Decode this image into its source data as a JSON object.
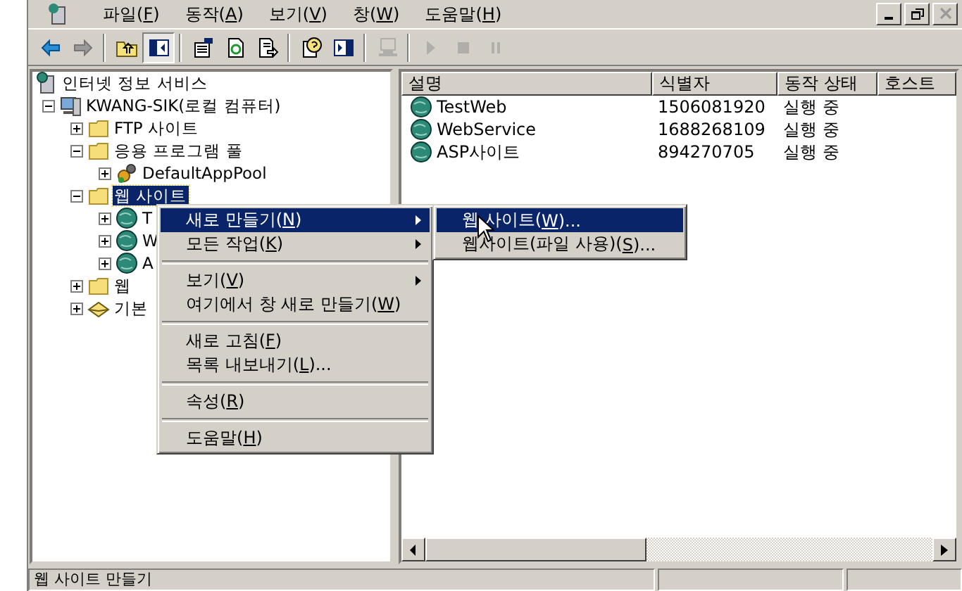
{
  "window": {
    "controls": [
      {
        "kind": "minimize",
        "disabled": false
      },
      {
        "kind": "restore",
        "disabled": false
      },
      {
        "kind": "close",
        "disabled": true
      }
    ]
  },
  "menu_bar": [
    {
      "before": "파일(",
      "key": "F",
      "after": ")"
    },
    {
      "before": "동작(",
      "key": "A",
      "after": ")"
    },
    {
      "before": "보기(",
      "key": "V",
      "after": ")"
    },
    {
      "before": "창(",
      "key": "W",
      "after": ")"
    },
    {
      "before": "도움말(",
      "key": "H",
      "after": ")"
    }
  ],
  "toolbar": [
    {
      "kind": "back",
      "disabled": false,
      "pressed": false
    },
    {
      "kind": "forward",
      "disabled": false,
      "pressed": false
    },
    {
      "kind": "separator"
    },
    {
      "kind": "up",
      "disabled": false,
      "pressed": false
    },
    {
      "kind": "tree",
      "disabled": false,
      "pressed": true
    },
    {
      "kind": "separator"
    },
    {
      "kind": "properties",
      "disabled": false,
      "pressed": false
    },
    {
      "kind": "refresh",
      "disabled": false,
      "pressed": false
    },
    {
      "kind": "export",
      "disabled": false,
      "pressed": false
    },
    {
      "kind": "separator"
    },
    {
      "kind": "help",
      "disabled": false,
      "pressed": false
    },
    {
      "kind": "pane",
      "disabled": false,
      "pressed": false
    },
    {
      "kind": "separator"
    },
    {
      "kind": "computer",
      "disabled": true,
      "pressed": false
    },
    {
      "kind": "separator"
    },
    {
      "kind": "play",
      "disabled": true,
      "pressed": false
    },
    {
      "kind": "stop",
      "disabled": true,
      "pressed": false
    },
    {
      "kind": "pause",
      "disabled": true,
      "pressed": false
    }
  ],
  "tree": [
    {
      "label": "인터넷 정보 서비스",
      "kind": "services",
      "selected": false,
      "children": [
        {
          "label": "KWANG-SIK(로컬 컴퓨터)",
          "kind": "computer",
          "selected": false,
          "expanded": true,
          "children": [
            {
              "label": "FTP 사이트",
              "kind": "folder",
              "selected": false,
              "expanded": false
            },
            {
              "label": "응용 프로그램 풀",
              "kind": "folder",
              "selected": false,
              "expanded": true,
              "children": [
                {
                  "label": "DefaultAppPool",
                  "kind": "pool",
                  "selected": false,
                  "expanded": false
                }
              ]
            },
            {
              "label": "웹 사이트",
              "kind": "folder",
              "selected": true,
              "expanded": true,
              "children": [
                {
                  "label": "T",
                  "kind": "site",
                  "selected": false,
                  "expanded": false
                },
                {
                  "label": "W",
                  "kind": "site",
                  "selected": false,
                  "expanded": false
                },
                {
                  "label": "A",
                  "kind": "site",
                  "selected": false,
                  "expanded": false
                }
              ]
            },
            {
              "label": "웹",
              "kind": "folder",
              "selected": false,
              "expanded": false
            },
            {
              "label": "기본",
              "kind": "mail",
              "selected": false,
              "expanded": false
            }
          ]
        }
      ]
    }
  ],
  "list": {
    "columns": [
      "설명",
      "식별자",
      "동작 상태",
      "호스트"
    ],
    "rows": [
      [
        "TestWeb",
        "1506081920",
        "실행 중"
      ],
      [
        "WebService",
        "1688268109",
        "실행 중"
      ],
      [
        "ASP사이트",
        "894270705",
        "실행 중"
      ]
    ]
  },
  "context_menu": {
    "sections": [
      [
        {
          "before": "새로 만들기(",
          "key": "N",
          "after": ")",
          "submenu": true,
          "selected": true
        },
        {
          "before": "모든 작업(",
          "key": "K",
          "after": ")",
          "submenu": true,
          "selected": false
        }
      ],
      [
        {
          "before": "보기(",
          "key": "V",
          "after": ")",
          "submenu": true,
          "selected": false
        },
        {
          "before": "여기에서 창 새로 만들기(",
          "key": "W",
          "after": ")",
          "submenu": false,
          "selected": false
        }
      ],
      [
        {
          "before": "새로 고침(",
          "key": "F",
          "after": ")",
          "submenu": false,
          "selected": false
        },
        {
          "before": "목록 내보내기(",
          "key": "L",
          "after": ")...",
          "submenu": false,
          "selected": false
        }
      ],
      [
        {
          "before": "속성(",
          "key": "R",
          "after": ")",
          "submenu": false,
          "selected": false
        }
      ],
      [
        {
          "before": "도움말(",
          "key": "H",
          "after": ")",
          "submenu": false,
          "selected": false
        }
      ]
    ]
  },
  "submenu": [
    {
      "before": "웹 사이트(",
      "key": "W",
      "after": ")...",
      "selected": true
    },
    {
      "before": "웹사이트(파일 사용)(",
      "key": "S",
      "after": ")...",
      "selected": false
    }
  ],
  "status_bar": "웹 사이트 만들기"
}
